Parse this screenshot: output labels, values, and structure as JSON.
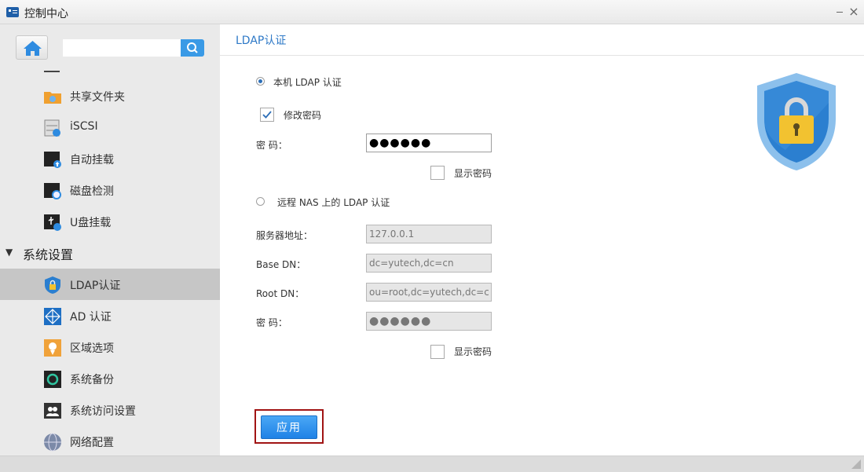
{
  "window": {
    "title": "控制中心"
  },
  "sidebar": {
    "search_placeholder": "",
    "items_top": [
      {
        "label": "共享文件夹",
        "icon": "shared-folder-icon"
      },
      {
        "label": "iSCSI",
        "icon": "iscsi-icon"
      },
      {
        "label": "自动挂载",
        "icon": "auto-mount-icon"
      },
      {
        "label": "磁盘检测",
        "icon": "disk-check-icon"
      },
      {
        "label": "U盘挂载",
        "icon": "usb-mount-icon"
      }
    ],
    "section": {
      "label": "系统设置",
      "arrow": "▼"
    },
    "items_system": [
      {
        "label": "LDAP认证",
        "icon": "ldap-icon",
        "active": true
      },
      {
        "label": "AD 认证",
        "icon": "ad-icon"
      },
      {
        "label": "区域选项",
        "icon": "region-icon"
      },
      {
        "label": "系统备份",
        "icon": "backup-icon"
      },
      {
        "label": "系统访问设置",
        "icon": "access-icon"
      },
      {
        "label": "网络配置",
        "icon": "network-icon"
      }
    ]
  },
  "content": {
    "title": "LDAP认证",
    "local": {
      "radio_label": "本机 LDAP 认证",
      "selected": true,
      "change_pw_label": "修改密码",
      "change_pw_checked": true,
      "password_label": "密 码：",
      "password_value": "●●●●●●",
      "show_pw_label": "显示密码"
    },
    "remote": {
      "radio_label": "远程 NAS 上的 LDAP 认证",
      "selected": false,
      "server_label": "服务器地址：",
      "server_value": "127.0.0.1",
      "basedn_label": "Base DN：",
      "basedn_value": "dc=yutech,dc=cn",
      "rootdn_label": "Root DN：",
      "rootdn_value": "ou=root,dc=yutech,dc=cn",
      "password_label": "密 码：",
      "password_value": "●●●●●●",
      "show_pw_label": "显示密码"
    },
    "apply_label": "应用"
  },
  "colors": {
    "accent": "#2e79c7",
    "button": "#2a8ef0",
    "highlight_frame": "#a11414",
    "shield": "#2b7fd0"
  }
}
